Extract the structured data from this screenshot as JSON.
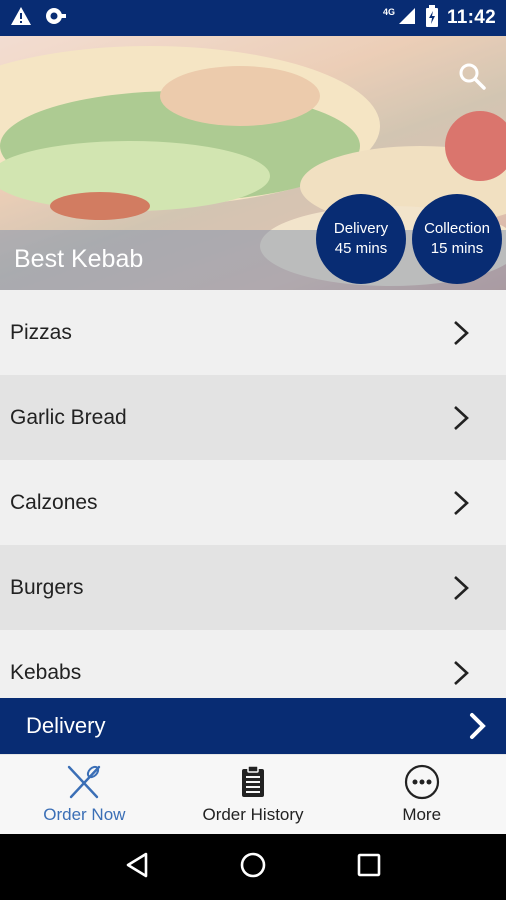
{
  "status_bar": {
    "network_label": "4G",
    "time": "11:42",
    "icons": [
      "warning-icon",
      "camera-icon",
      "signal-icon",
      "battery-icon"
    ]
  },
  "hero": {
    "restaurant_name": "Best Kebab",
    "delivery_badge": {
      "title": "Delivery",
      "time": "45 mins"
    },
    "collection_badge": {
      "title": "Collection",
      "time": "15 mins"
    }
  },
  "menu": {
    "items": [
      {
        "label": "Pizzas"
      },
      {
        "label": "Garlic Bread"
      },
      {
        "label": "Calzones"
      },
      {
        "label": "Burgers"
      },
      {
        "label": "Kebabs"
      }
    ]
  },
  "delivery_bar": {
    "label": "Delivery"
  },
  "bottom_nav": {
    "items": [
      {
        "label": "Order Now",
        "icon": "fork-knife-icon"
      },
      {
        "label": "Order History",
        "icon": "clipboard-icon"
      },
      {
        "label": "More",
        "icon": "more-icon"
      }
    ]
  },
  "colors": {
    "primary": "#082c73",
    "accent": "#3b6fb6"
  }
}
